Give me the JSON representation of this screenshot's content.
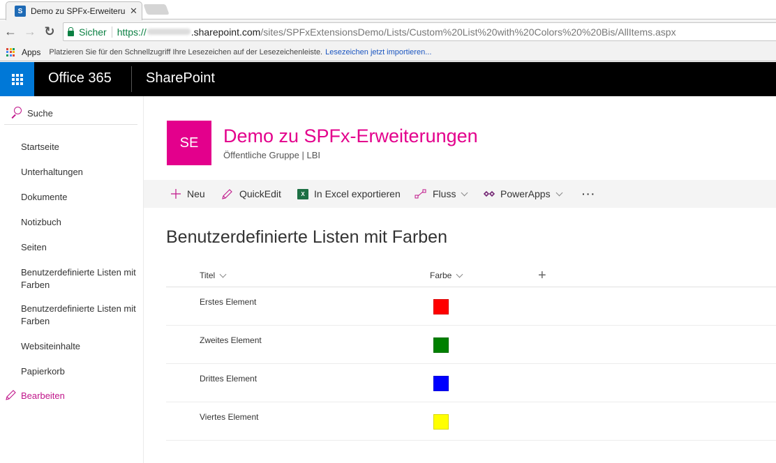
{
  "browser": {
    "tab_title": "Demo zu SPFx-Erweiterun",
    "tab_favicon": "S",
    "secure_label": "Sicher",
    "url_protocol": "https://",
    "url_host": ".sharepoint.com",
    "url_path": "/sites/SPFxExtensionsDemo/Lists/Custom%20List%20with%20Colors%20%20Bis/AllItems.aspx",
    "back_icon": "←",
    "forward_icon": "→",
    "reload_icon": "↻",
    "close_icon": "✕",
    "bookmarks": {
      "apps_label": "Apps",
      "hint_text": "Platzieren Sie für den Schnellzugriff Ihre Lesezeichen auf der Lesezeichenleiste.",
      "import_link": "Lesezeichen jetzt importieren..."
    }
  },
  "suitebar": {
    "brand": "Office 365",
    "app_name": "SharePoint",
    "accent": "#0078d7"
  },
  "leftnav": {
    "search_label": "Suche",
    "items": [
      {
        "label": "Startseite"
      },
      {
        "label": "Unterhaltungen"
      },
      {
        "label": "Dokumente"
      },
      {
        "label": "Notizbuch"
      },
      {
        "label": "Seiten"
      },
      {
        "label": "Benutzerdefinierte Listen mit Farben"
      },
      {
        "label": "Benutzerdefinierte Listen mit Farben"
      },
      {
        "label": "Websiteinhalte"
      },
      {
        "label": "Papierkorb"
      }
    ],
    "edit_label": "Bearbeiten"
  },
  "site": {
    "logo_initials": "SE",
    "title": "Demo zu SPFx-Erweiterungen",
    "subtitle": "Öffentliche Gruppe  |  LBI",
    "theme_color": "#e3008c"
  },
  "commandbar": {
    "new_label": "Neu",
    "quickedit_label": "QuickEdit",
    "excel_label": "In Excel exportieren",
    "flow_label": "Fluss",
    "powerapps_label": "PowerApps",
    "more_label": "···"
  },
  "list": {
    "title": "Benutzerdefinierte Listen mit Farben",
    "columns": [
      {
        "label": "Titel"
      },
      {
        "label": "Farbe"
      }
    ],
    "add_column_icon": "+",
    "rows": [
      {
        "title": "Erstes Element",
        "color": "#ff0000"
      },
      {
        "title": "Zweites Element",
        "color": "#008000"
      },
      {
        "title": "Drittes Element",
        "color": "#0000ff"
      },
      {
        "title": "Viertes Element",
        "color": "#ffff00"
      }
    ]
  }
}
